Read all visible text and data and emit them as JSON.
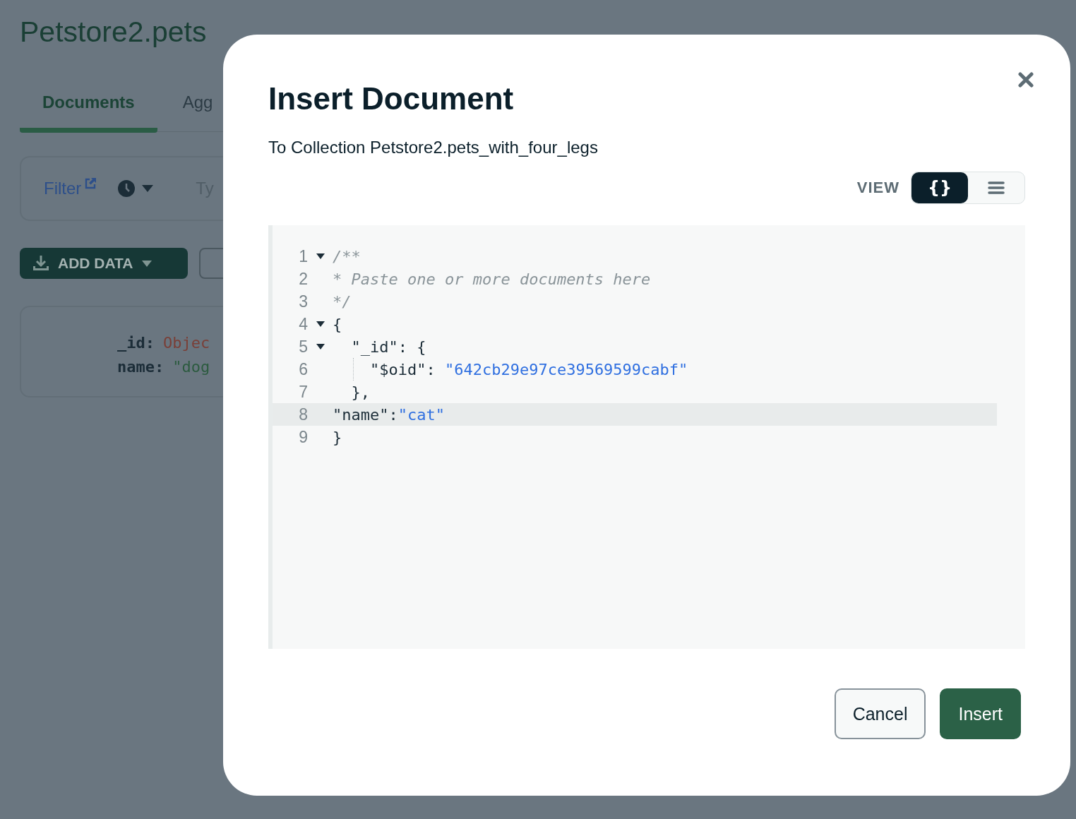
{
  "background": {
    "title": "Petstore2.pets",
    "tabs": [
      {
        "label": "Documents",
        "selected": true
      },
      {
        "label": "Agg",
        "selected": false
      }
    ],
    "filter": {
      "label": "Filter",
      "placeholder": "Ty"
    },
    "add_data_button": "ADD DATA",
    "document": {
      "fields": [
        {
          "key": "_id:",
          "value": "Objec",
          "kind": "object"
        },
        {
          "key": "name:",
          "value": "\"dog",
          "kind": "string"
        }
      ]
    }
  },
  "dialog": {
    "title": "Insert Document",
    "subtitle": "To Collection Petstore2.pets_with_four_legs",
    "view_label": "VIEW",
    "view_options": [
      {
        "kind": "json",
        "label": "{}",
        "selected": true
      },
      {
        "kind": "list",
        "selected": false
      }
    ],
    "editor": {
      "lines": [
        {
          "number": "1",
          "foldable": true,
          "highlighted": false,
          "guide": false,
          "tokens": [
            {
              "kind": "comment",
              "text": "/**"
            }
          ]
        },
        {
          "number": "2",
          "foldable": false,
          "highlighted": false,
          "guide": false,
          "tokens": [
            {
              "kind": "comment",
              "text": "* Paste one or more documents here"
            }
          ]
        },
        {
          "number": "3",
          "foldable": false,
          "highlighted": false,
          "guide": false,
          "tokens": [
            {
              "kind": "comment",
              "text": "*/"
            }
          ]
        },
        {
          "number": "4",
          "foldable": true,
          "highlighted": false,
          "guide": false,
          "tokens": [
            {
              "kind": "plain",
              "text": "{"
            }
          ]
        },
        {
          "number": "5",
          "foldable": true,
          "highlighted": false,
          "guide": false,
          "tokens": [
            {
              "kind": "plain",
              "text": "  \"_id\": {"
            }
          ]
        },
        {
          "number": "6",
          "foldable": false,
          "highlighted": false,
          "guide": true,
          "tokens": [
            {
              "kind": "plain",
              "text": "    \"$oid\": "
            },
            {
              "kind": "string",
              "text": "\"642cb29e97ce39569599cabf\""
            }
          ]
        },
        {
          "number": "7",
          "foldable": false,
          "highlighted": false,
          "guide": false,
          "tokens": [
            {
              "kind": "plain",
              "text": "  },"
            }
          ]
        },
        {
          "number": "8",
          "foldable": false,
          "highlighted": true,
          "guide": false,
          "tokens": [
            {
              "kind": "plain",
              "text": "\"name\":"
            },
            {
              "kind": "string",
              "text": "\"cat\""
            }
          ]
        },
        {
          "number": "9",
          "foldable": false,
          "highlighted": false,
          "guide": false,
          "tokens": [
            {
              "kind": "plain",
              "text": "}"
            }
          ]
        }
      ]
    },
    "buttons": [
      {
        "label": "Cancel",
        "kind": "secondary"
      },
      {
        "label": "Insert",
        "kind": "primary"
      }
    ]
  }
}
